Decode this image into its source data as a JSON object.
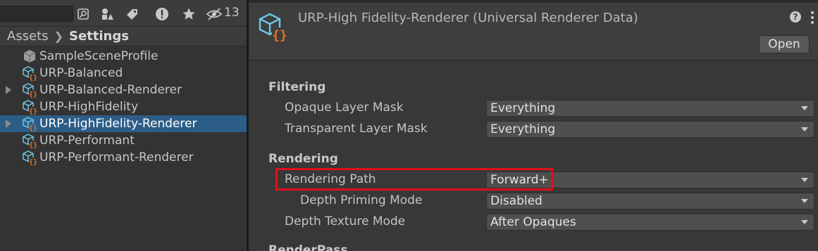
{
  "project_panel": {
    "toolbar": {
      "hidden_count": "13",
      "icons": [
        "search-field",
        "scene-search-icon",
        "filter-by-type-icon",
        "filter-by-label-icon",
        "console-warning-icon",
        "favorites-star-icon",
        "hidden-packages-eye-icon"
      ]
    },
    "breadcrumb": {
      "root": "Assets",
      "current": "Settings"
    },
    "assets": [
      {
        "label": "SampleSceneProfile",
        "icon": "volume-profile-icon",
        "foldable": false,
        "selected": false
      },
      {
        "label": "URP-Balanced",
        "icon": "urp-asset-icon",
        "foldable": false,
        "selected": false
      },
      {
        "label": "URP-Balanced-Renderer",
        "icon": "urp-asset-icon",
        "foldable": true,
        "selected": false
      },
      {
        "label": "URP-HighFidelity",
        "icon": "urp-asset-icon",
        "foldable": false,
        "selected": false
      },
      {
        "label": "URP-HighFidelity-Renderer",
        "icon": "urp-asset-icon",
        "foldable": true,
        "selected": true
      },
      {
        "label": "URP-Performant",
        "icon": "urp-asset-icon",
        "foldable": false,
        "selected": false
      },
      {
        "label": "URP-Performant-Renderer",
        "icon": "urp-asset-icon",
        "foldable": false,
        "selected": false
      }
    ]
  },
  "inspector": {
    "title": "URP-High Fidelity-Renderer (Universal Renderer Data)",
    "open_label": "Open",
    "help_glyph": "?",
    "sections": {
      "filtering": "Filtering",
      "rendering": "Rendering",
      "next": "RenderPass"
    },
    "properties": {
      "opaque_layer_mask": {
        "label": "Opaque Layer Mask",
        "value": "Everything"
      },
      "transparent_layer_mask": {
        "label": "Transparent Layer Mask",
        "value": "Everything"
      },
      "rendering_path": {
        "label": "Rendering Path",
        "value": "Forward+"
      },
      "depth_priming_mode": {
        "label": "Depth Priming Mode",
        "value": "Disabled"
      },
      "depth_texture_mode": {
        "label": "Depth Texture Mode",
        "value": "After Opaques"
      }
    },
    "highlight_color": "#e0101c"
  },
  "colors": {
    "selection": "#2c5d87",
    "icon_cyan": "#6ec6e6",
    "icon_orange": "#f07020"
  }
}
